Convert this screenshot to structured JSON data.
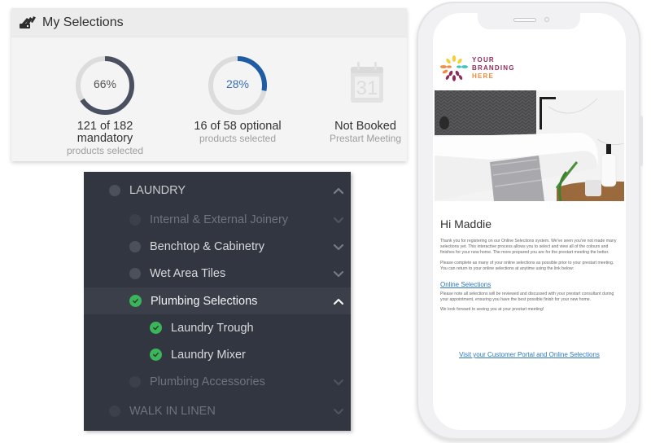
{
  "selections_card": {
    "title": "My Selections",
    "stats": [
      {
        "percent": 66,
        "percent_label": "66%",
        "main": [
          "121 of 182",
          "mandatory"
        ],
        "sub": "products selected",
        "ring_color": "#4b5060",
        "label_color": "#555555"
      },
      {
        "percent": 28,
        "percent_label": "28%",
        "main": [
          "16 of 58 optional"
        ],
        "sub": "products selected",
        "ring_color": "#1f5ca3",
        "label_color": "#3c6fb3"
      },
      {
        "icon": "calendar-31-icon",
        "calendar_day": "31",
        "main": [
          "Not Booked"
        ],
        "sub": "Prestart Meeting"
      }
    ]
  },
  "tree_menu": {
    "items": [
      {
        "label": "LAUNDRY",
        "level": 0,
        "status": "pending",
        "tone": "upper",
        "chevron": "up"
      },
      {
        "label": "Internal & External Joinery",
        "level": 1,
        "status": "pending",
        "tone": "dim",
        "chevron": "down"
      },
      {
        "label": "Benchtop & Cabinetry",
        "level": 1,
        "status": "pending",
        "tone": "normal",
        "chevron": "down"
      },
      {
        "label": "Wet Area Tiles",
        "level": 1,
        "status": "pending",
        "tone": "normal",
        "chevron": "down"
      },
      {
        "label": "Plumbing Selections",
        "level": 1,
        "status": "complete",
        "tone": "bright",
        "chevron": "up",
        "active": true
      },
      {
        "label": "Laundry Trough",
        "level": 2,
        "status": "complete",
        "tone": "normal"
      },
      {
        "label": "Laundry Mixer",
        "level": 2,
        "status": "complete",
        "tone": "normal"
      },
      {
        "label": "Plumbing Accessories",
        "level": 1,
        "status": "pending",
        "tone": "dim",
        "chevron": "down"
      },
      {
        "label": "WALK IN LINEN",
        "level": 0,
        "status": "pending",
        "tone": "dim",
        "chevron": "down"
      }
    ],
    "check_color": "#3bb55a"
  },
  "email": {
    "brand": [
      "YOUR",
      "BRANDING",
      "HERE"
    ],
    "greeting": "Hi Maddie",
    "paragraphs": [
      "Thank you for registering on our Online Selections system. We've seen you've not made many selections yet. This interactive process allows you to select and view all of the colours and finishes for your new home. The more prepared you are for the prestart meeting the better.",
      "Please complete as many of your online selections as possible prior to your prestart meeting. You can return to your online selections at anytime using the link below:"
    ],
    "link_online_selections": "Online Selections",
    "paragraphs_after": [
      "Please note all selections will be reviewed and discussed with your prestart consultant during your appointment, ensuring you have the best possible finish for your new home.",
      "We look forward to seeing you at your prestart meeting!"
    ],
    "portal_link": "Visit your Customer Portal and Online Selections",
    "link_color": "#2e78b7"
  }
}
